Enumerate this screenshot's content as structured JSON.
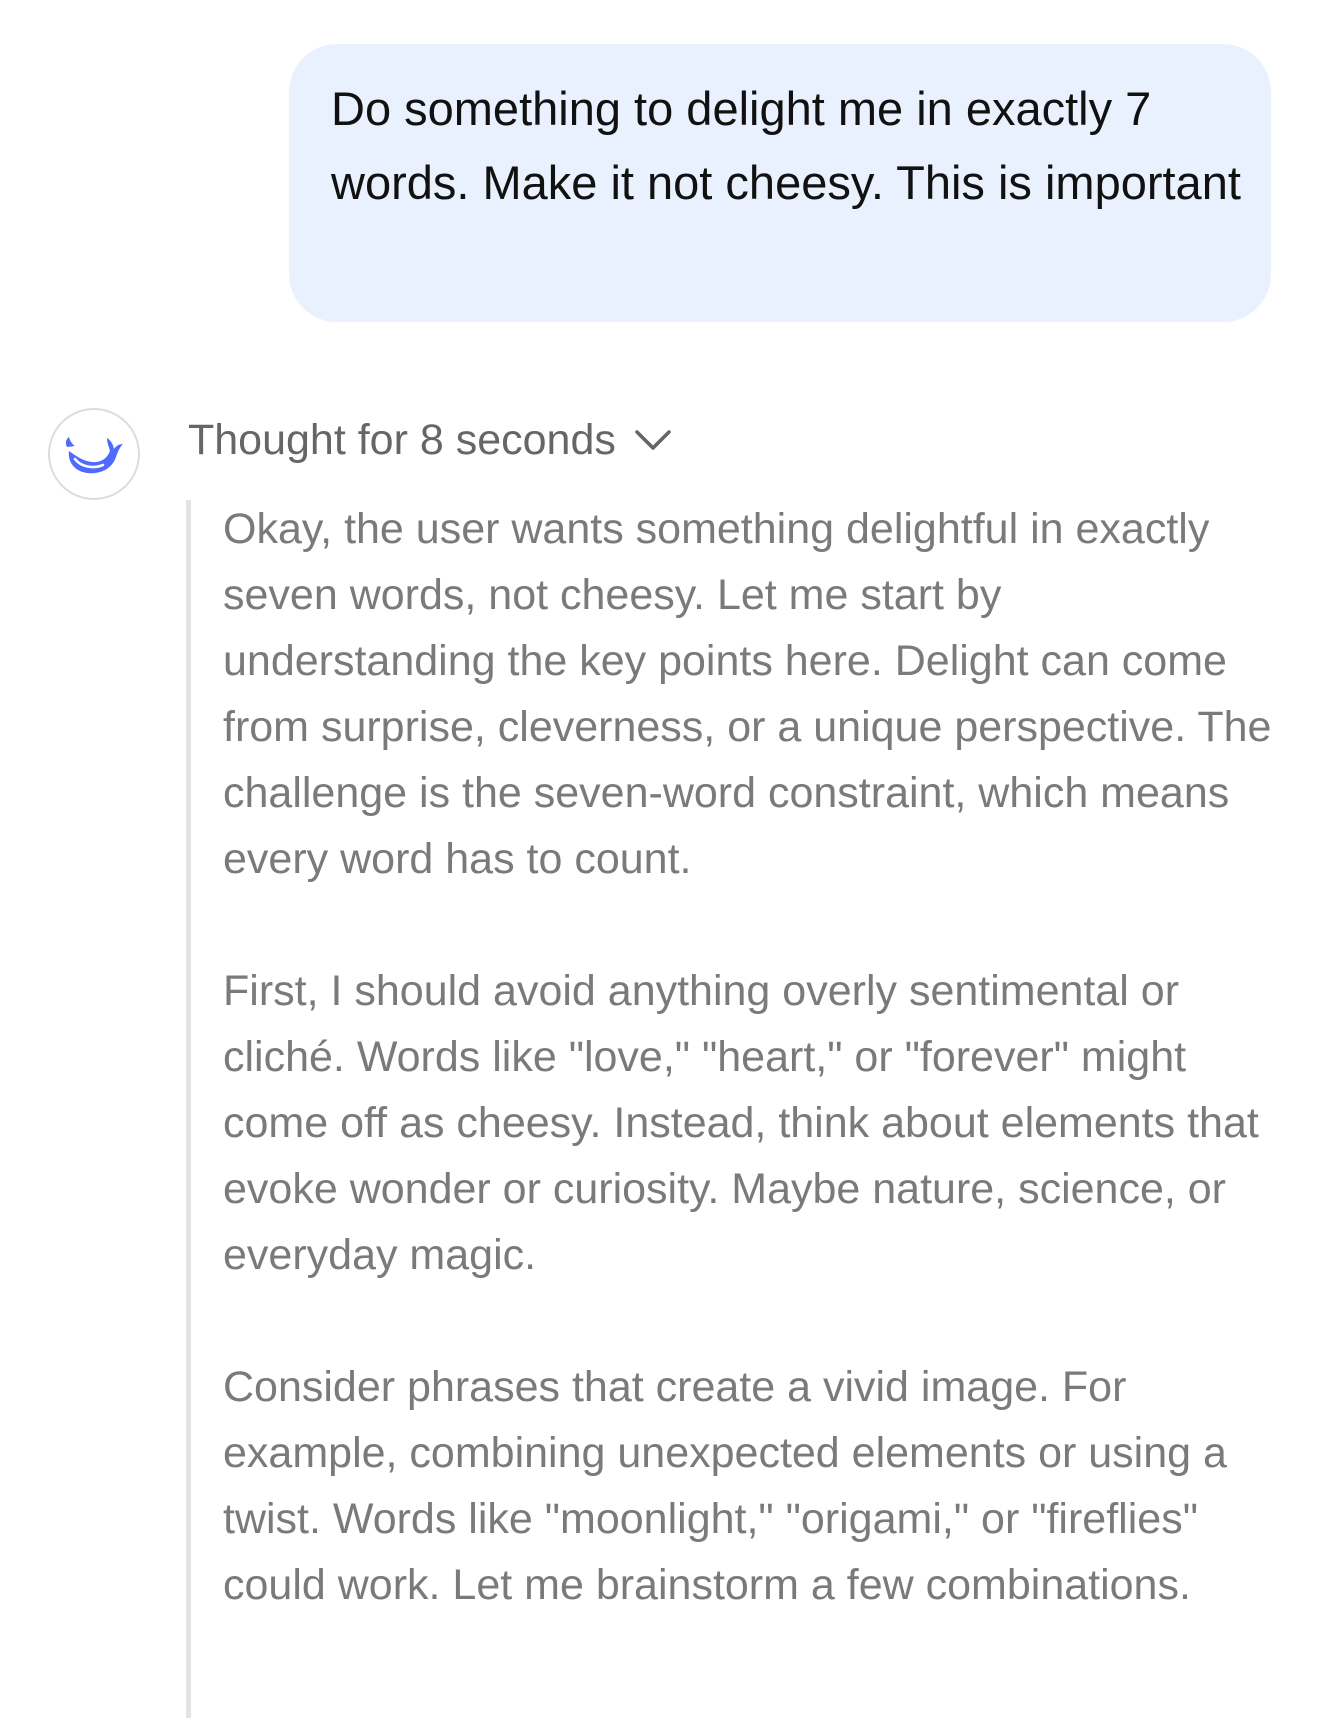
{
  "user_message": {
    "text": "Do something to delight me in exactly 7 words. Make it not cheesy. This is important"
  },
  "assistant": {
    "avatar_icon": "whale-logo-icon",
    "avatar_color": "#4d6bfe",
    "thought_label": "Thought for 8 seconds",
    "thought_toggle_icon": "chevron-down-icon",
    "thought_paragraphs": [
      "Okay, the user wants something delightful in exactly seven words, not cheesy. Let me start by understanding the key points here. Delight can come from surprise, cleverness, or a unique perspective. The challenge is the seven-word constraint, which means every word has to count.",
      "First, I should avoid anything overly sentimental or cliché. Words like \"love,\" \"heart,\" or \"forever\" might come off as cheesy. Instead, think about elements that evoke wonder or curiosity. Maybe nature, science, or everyday magic.",
      "Consider phrases that create a vivid image. For example, combining unexpected elements or using a twist. Words like \"moonlight,\" \"origami,\" or \"fireflies\" could work. Let me brainstorm a few combinations."
    ]
  },
  "colors": {
    "user_bubble_bg": "#e8f1fd",
    "thought_text": "#7a7a7a",
    "thought_bar": "#e4e4e4"
  }
}
